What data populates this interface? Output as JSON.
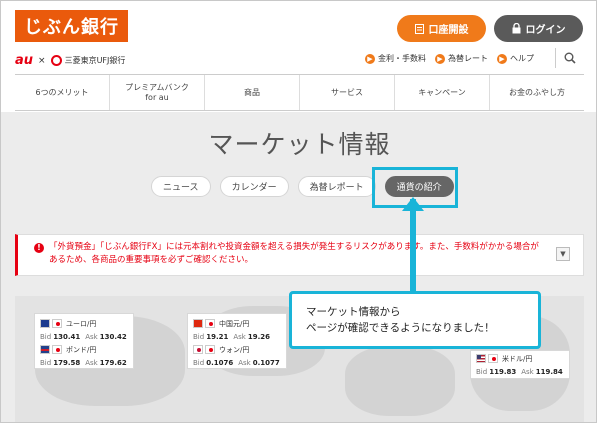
{
  "header": {
    "logo_text": "じぶん銀行",
    "partner_au": "au",
    "partner_x": "×",
    "partner_bank": "三菱東京UFJ銀行",
    "open_account_label": "口座開設",
    "login_label": "ログイン",
    "links": [
      {
        "label": "金利・手数料"
      },
      {
        "label": "為替レート"
      },
      {
        "label": "ヘルプ"
      }
    ]
  },
  "nav": {
    "items": [
      {
        "label": "6つのメリット"
      },
      {
        "label": "プレミアムバンク\nfor au"
      },
      {
        "label": "商品"
      },
      {
        "label": "サービス"
      },
      {
        "label": "キャンペーン"
      },
      {
        "label": "お金のふやし方"
      }
    ]
  },
  "main": {
    "title": "マーケット情報",
    "tabs": [
      {
        "label": "ニュース"
      },
      {
        "label": "カレンダー"
      },
      {
        "label": "為替レポート"
      },
      {
        "label": "通貨の紹介"
      }
    ],
    "notice": {
      "icon": "!",
      "text": "「外貨預金」「じぶん銀行FX」には元本割れや投資金額を超える損失が発生するリスクがあります。また、手数料がかかる場合があるため、各商品の重要事項を必ずご確認ください。",
      "toggle": "▼"
    }
  },
  "rates": [
    {
      "pair": "ユーロ/円",
      "bid_label": "Bid",
      "bid": "130.41",
      "ask_label": "Ask",
      "ask": "130.42"
    },
    {
      "pair": "ポンド/円",
      "bid_label": "Bid",
      "bid": "179.58",
      "ask_label": "Ask",
      "ask": "179.62"
    },
    {
      "pair": "中国元/円",
      "bid_label": "Bid",
      "bid": "19.21",
      "ask_label": "Ask",
      "ask": "19.26"
    },
    {
      "pair": "ウォン/円",
      "bid_label": "Bid",
      "bid": "0.1076",
      "ask_label": "Ask",
      "ask": "0.1077"
    },
    {
      "pair": "米ドル/円",
      "bid_label": "Bid",
      "bid": "119.83",
      "ask_label": "Ask",
      "ask": "119.84"
    }
  ],
  "callout": {
    "line1": "マーケット情報から",
    "line2": "ページが確認できるようになりました！"
  },
  "colors": {
    "brand_orange": "#ea5a0c",
    "highlight_cyan": "#19b4d8",
    "warning_red": "#e60012"
  }
}
